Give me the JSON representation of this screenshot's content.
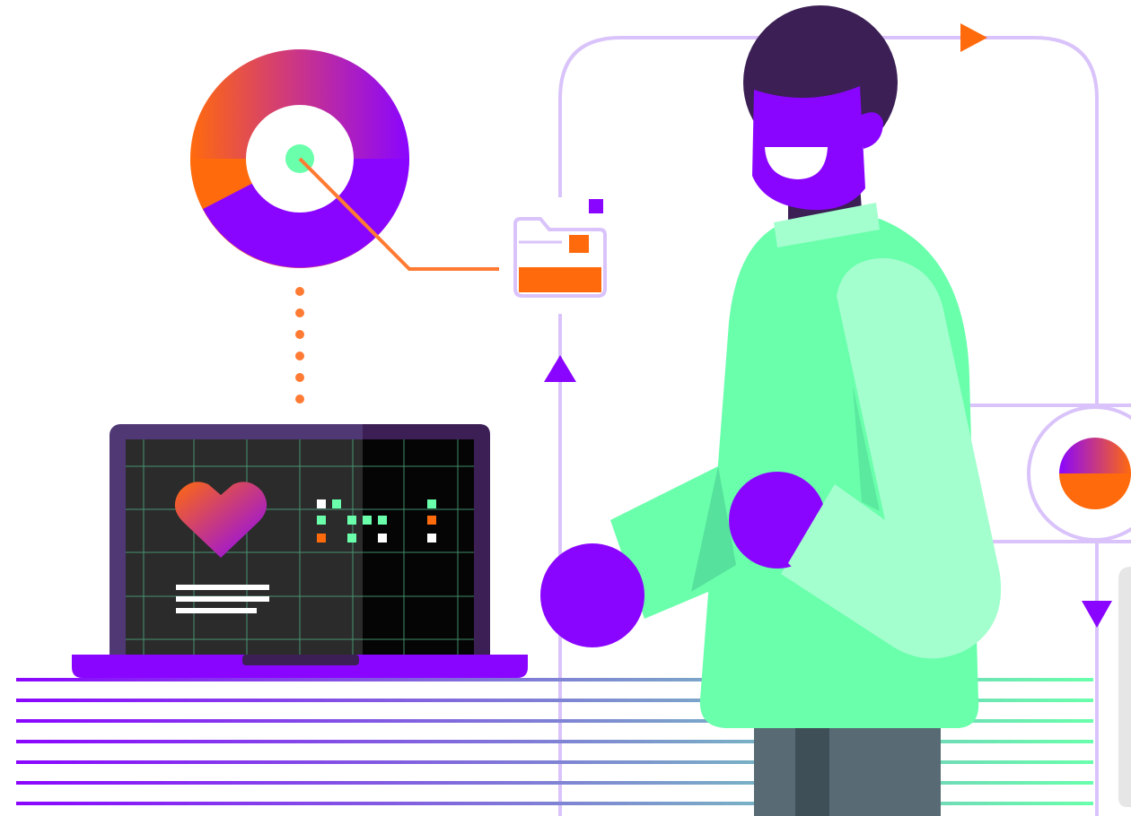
{
  "illustration": {
    "colors": {
      "purple": "#8a05ff",
      "orange": "#ff6a0d",
      "mint": "#69ffab",
      "mint_light": "#a4ffce",
      "lilac": "#d9c3fa",
      "dark_purple": "#3b1f55",
      "screen": "#232323",
      "pants": "#586b74"
    },
    "donut_chart": {
      "segments": [
        {
          "share": 0.4,
          "color": "#8a05ff"
        },
        {
          "share": 0.07,
          "color": "#ff6a0d"
        },
        {
          "share": 0.53,
          "color": "gradient-orange-purple"
        }
      ]
    },
    "badge_half_circle": {
      "top": "#8a05ff",
      "bottom": "#ff6a0d"
    },
    "folder": {
      "fill_level": 0.4
    },
    "laptop": {
      "screen_icons": [
        "heart-icon",
        "text-lines-icon",
        "pixel-pattern-icon"
      ]
    },
    "flow_arrows": [
      "arrow-right-icon",
      "arrow-up-icon",
      "arrow-down-icon"
    ],
    "stripes_count": 7
  }
}
